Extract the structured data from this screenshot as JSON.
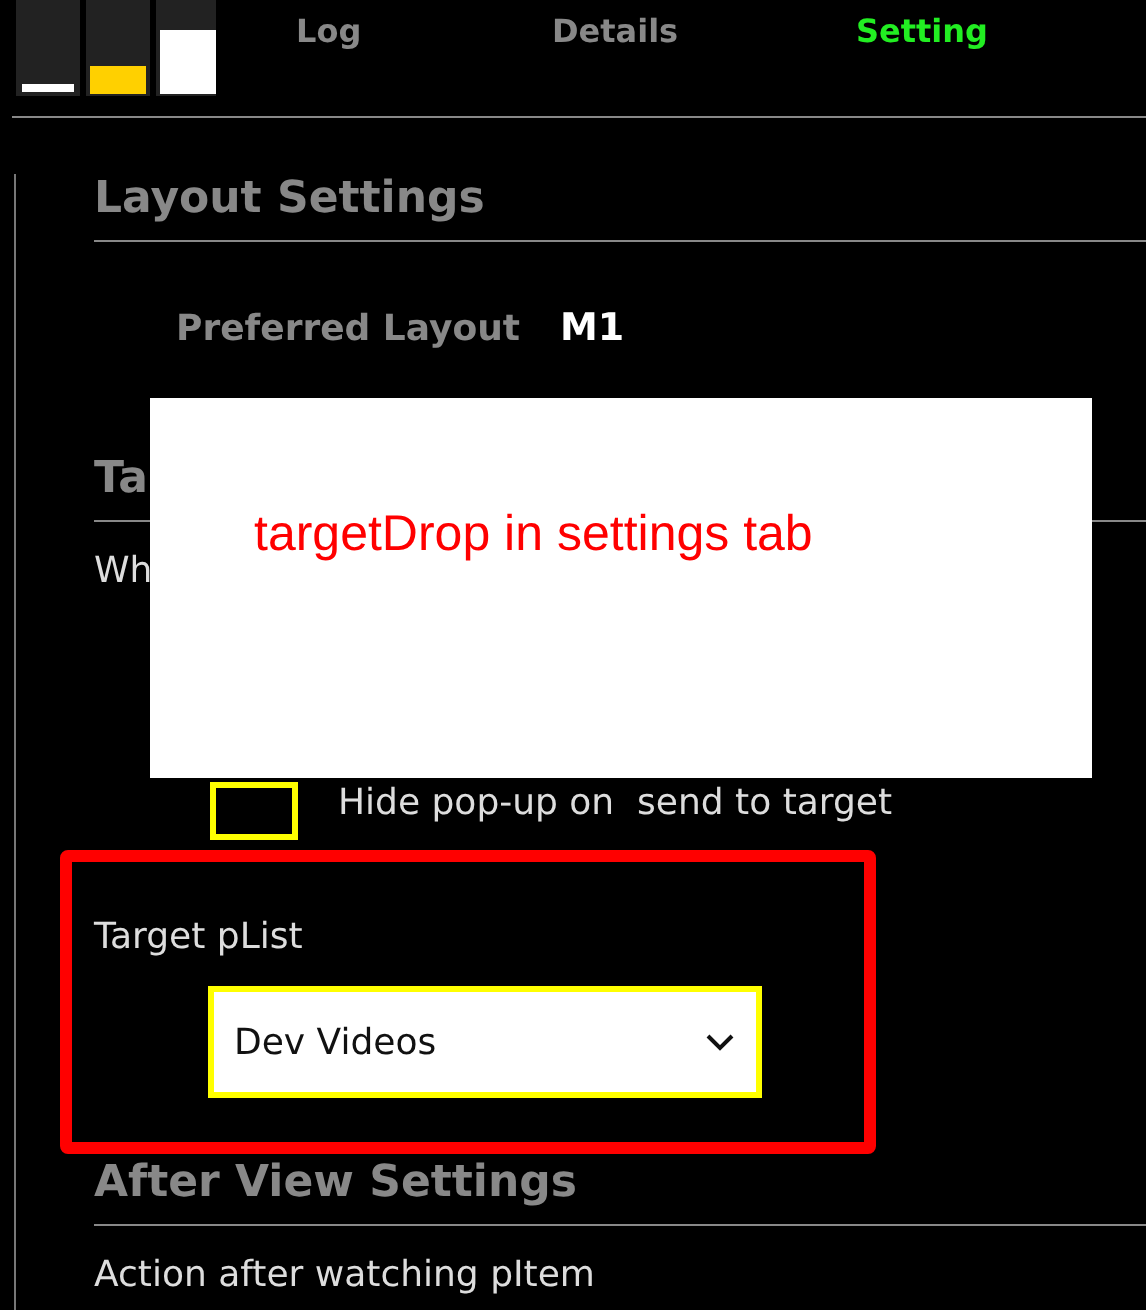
{
  "tabs": [
    {
      "label": "Log",
      "selected": false
    },
    {
      "label": "Details",
      "selected": false
    },
    {
      "label": "Setting",
      "selected": true
    }
  ],
  "layout_settings": {
    "heading": "Layout Settings",
    "preferred_layout": {
      "label": "Preferred Layout",
      "value": "M1"
    }
  },
  "target_settings": {
    "heading": "Ta",
    "text": "Wh",
    "hide_popup": {
      "label": "Hide pop-up on  send to target",
      "checked": false
    },
    "target_plist": {
      "label": "Target pList",
      "value": "Dev Videos"
    }
  },
  "after_view_settings": {
    "heading": "After View Settings",
    "text": "Action after watching pItem"
  },
  "annotation": {
    "note": "targetDrop in settings tab"
  }
}
